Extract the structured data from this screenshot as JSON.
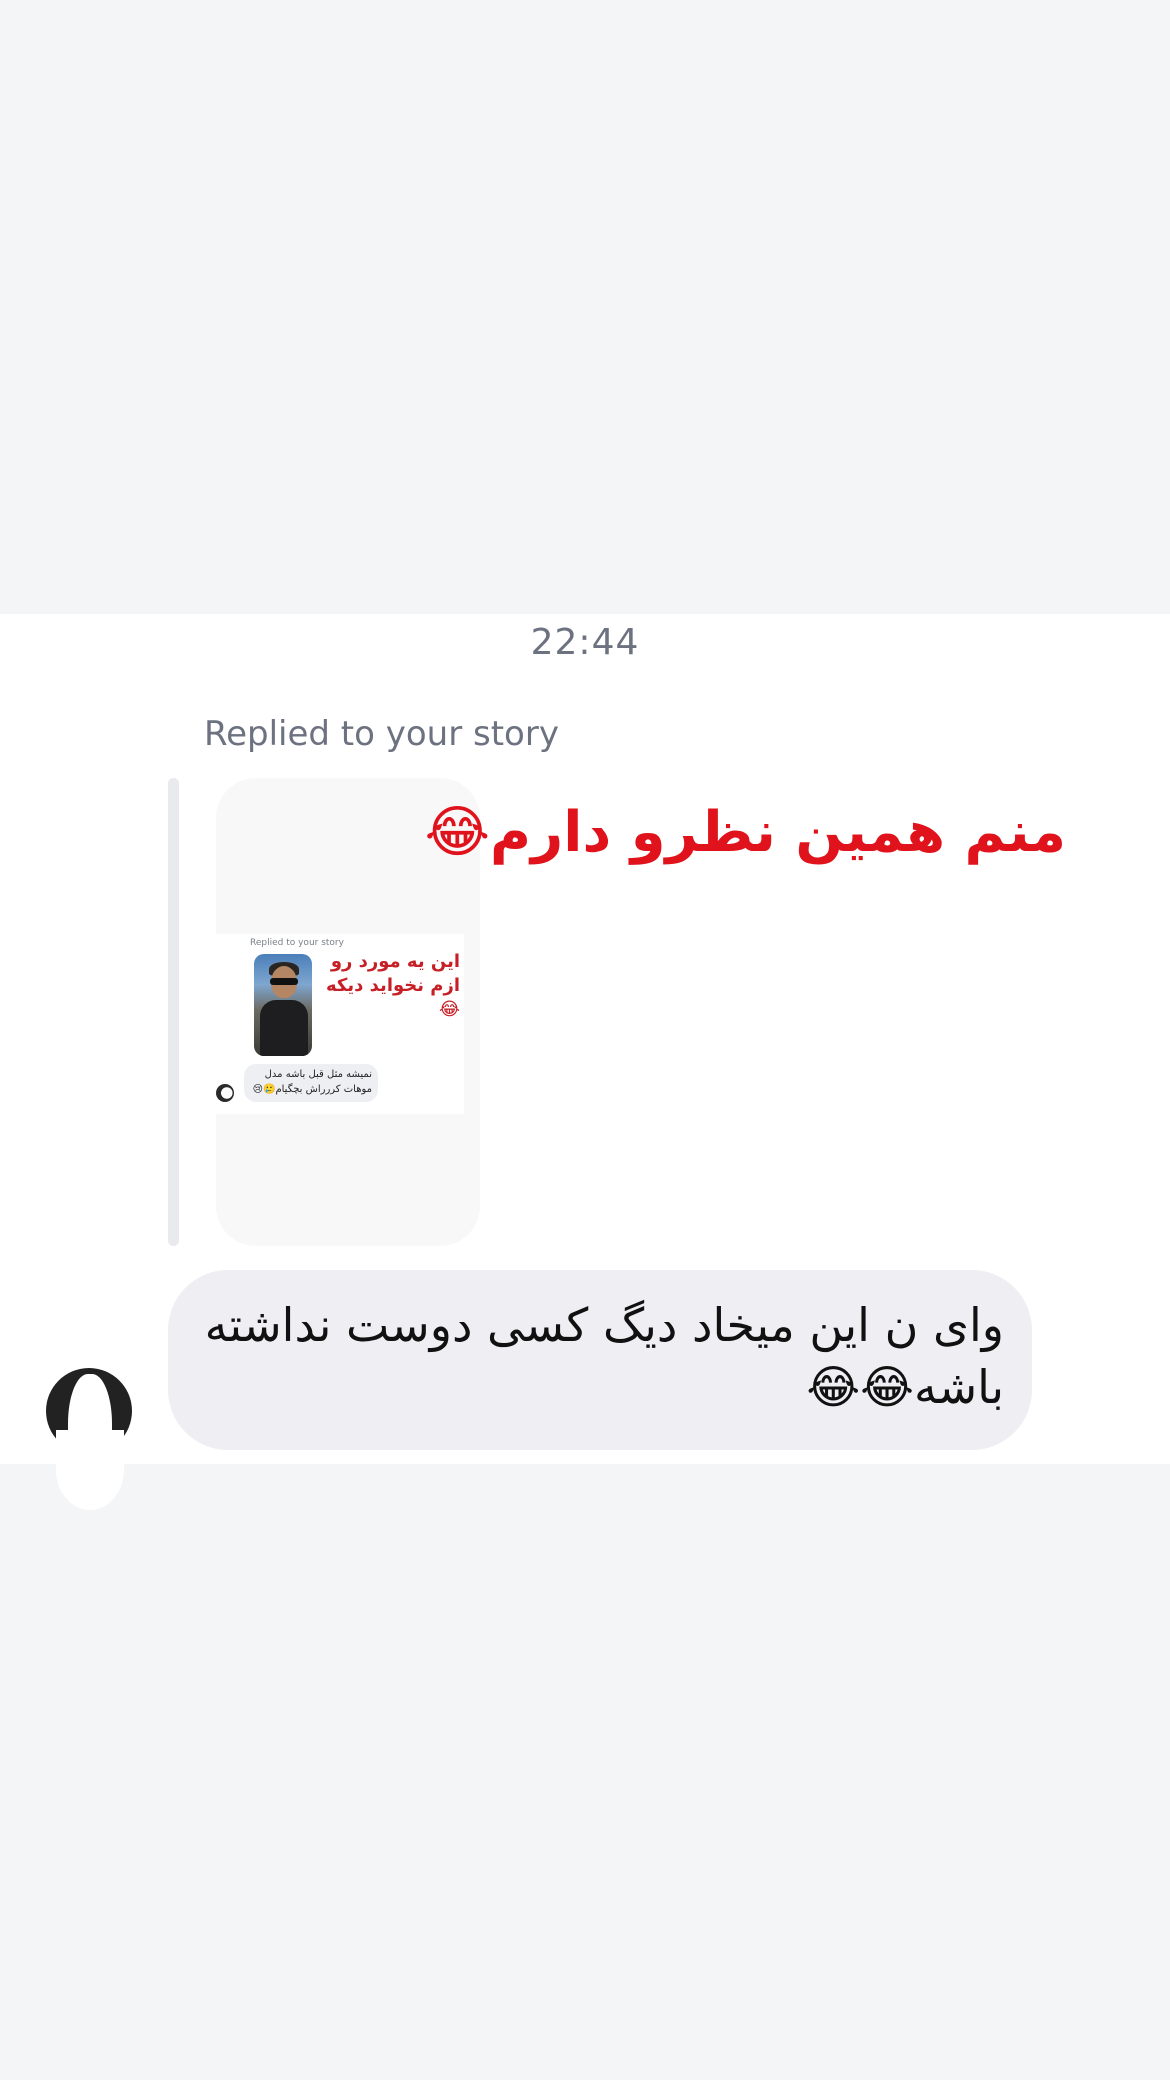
{
  "conversation": {
    "timestamp": "22:44",
    "story_reply": {
      "label": "Replied to your story",
      "reply_text": "منم همین نظرو دارم😂",
      "story_preview": {
        "label": "Replied to your story",
        "caption": "این یه مورد رو ازم نخواید دیکه😂",
        "bubble_text": "نمیشه مثل قبل باشه مدل موهات کررراش بچگیام🥲😢"
      }
    },
    "message": {
      "text": "وای ن این میخاد دیگ کسی دوست نداشته باشه😂😂"
    }
  },
  "colors": {
    "page_background": "#f4f5f7",
    "chat_background": "#ffffff",
    "bubble_background": "#efeff3",
    "reply_text": "#e0131c",
    "muted_text": "#6d7280"
  },
  "icons": {
    "sender_avatar": "profile-avatar",
    "story_thumbnail": "story-image-thumbnail"
  }
}
